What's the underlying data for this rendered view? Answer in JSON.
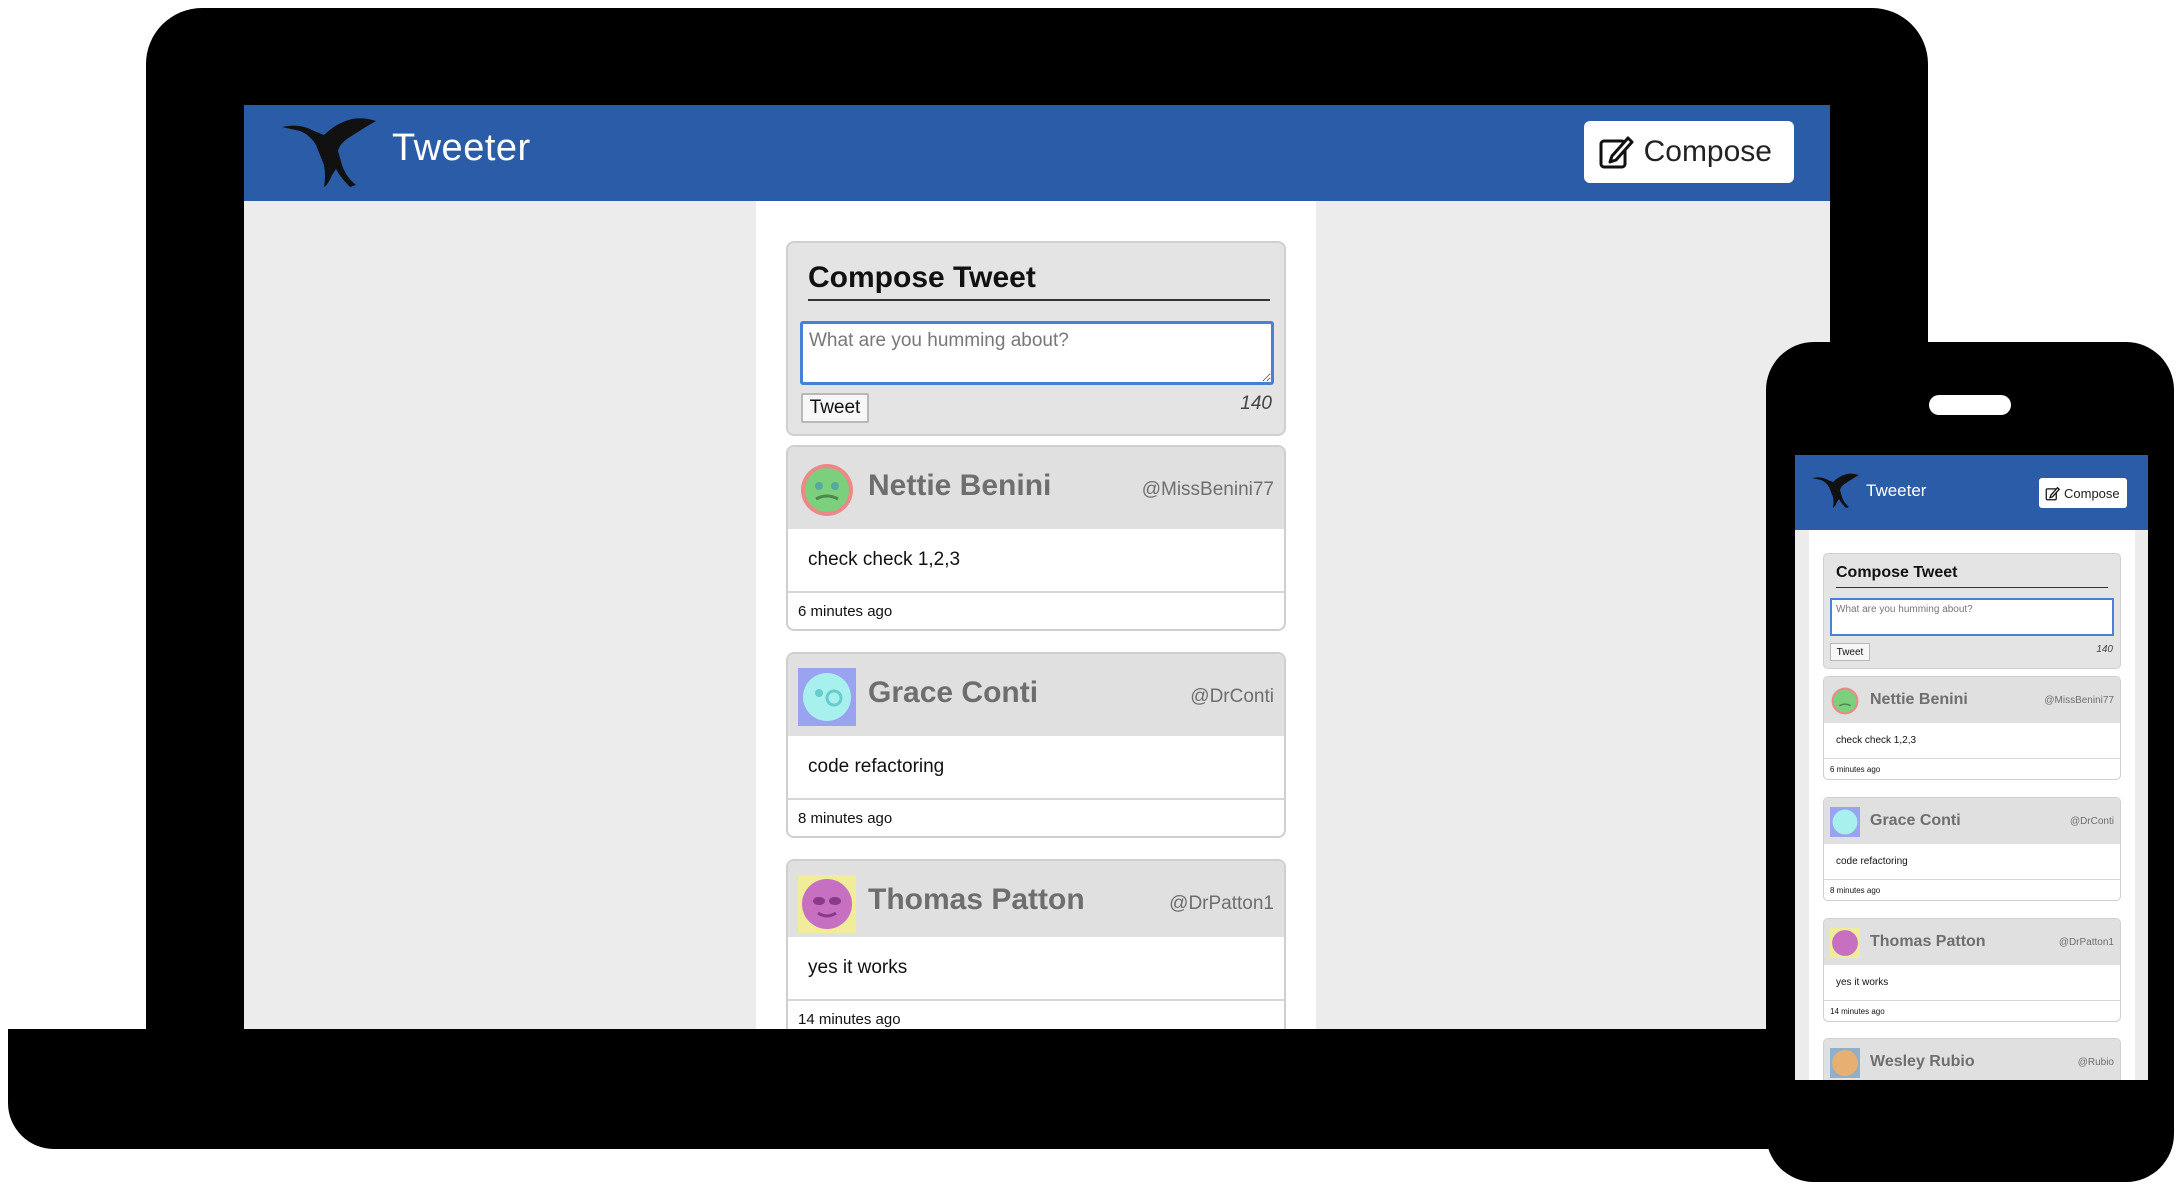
{
  "app": {
    "brand": "Tweeter",
    "compose_label": "Compose",
    "accent_color": "#2b5ca8"
  },
  "compose": {
    "title": "Compose Tweet",
    "placeholder": "What are you humming about?",
    "tweet_button": "Tweet",
    "counter": "140"
  },
  "tweets": [
    {
      "name": "Nettie Benini",
      "handle": "@MissBenini77",
      "text": "check check 1,2,3",
      "time": "6 minutes ago",
      "avatar": "green-face-icon"
    },
    {
      "name": "Grace Conti",
      "handle": "@DrConti",
      "text": "code refactoring",
      "time": "8 minutes ago",
      "avatar": "cyan-face-icon"
    },
    {
      "name": "Thomas Patton",
      "handle": "@DrPatton1",
      "text": "yes it works",
      "time": "14 minutes ago",
      "avatar": "purple-face-icon"
    },
    {
      "name": "Wesley Rubio",
      "handle": "@Rubio",
      "text": "",
      "time": "",
      "avatar": "orange-face-icon"
    }
  ]
}
